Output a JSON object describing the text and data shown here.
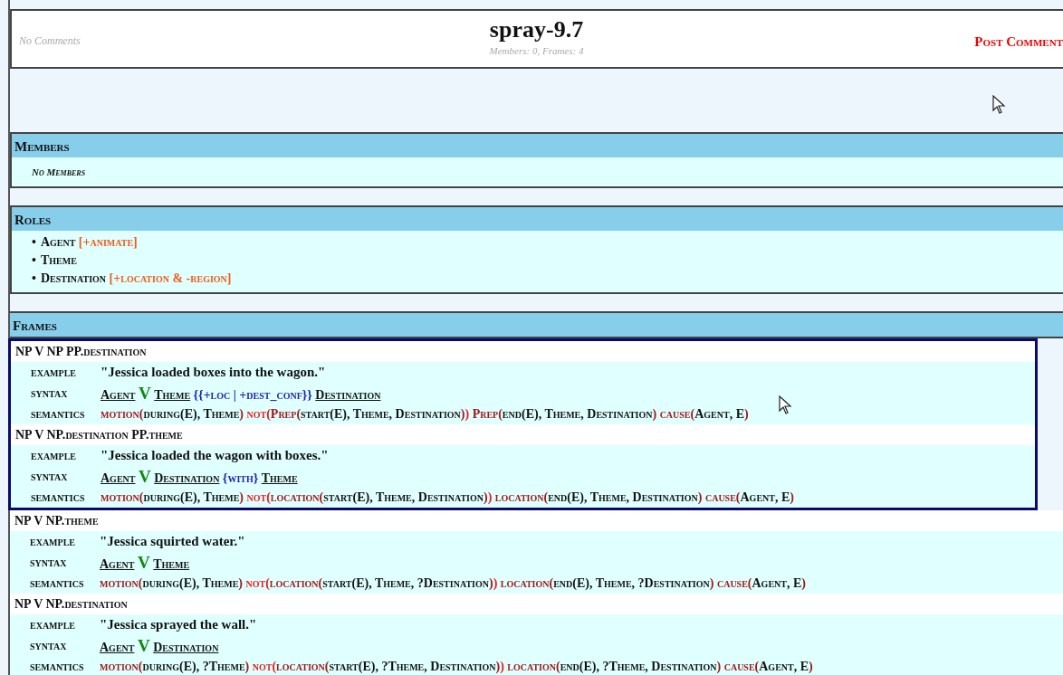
{
  "header": {
    "comments": "No Comments",
    "title": "spray-9.7",
    "subtitle": "Members: 0, Frames: 4",
    "post_link": "Post Comment"
  },
  "members": {
    "heading": "Members",
    "empty_text": "No Members"
  },
  "roles": {
    "heading": "Roles",
    "bullet": "•",
    "items": [
      {
        "name": "Agent",
        "restriction": "[+animate]"
      },
      {
        "name": "Theme"
      },
      {
        "name": "Destination",
        "restriction": "[+location & -region]"
      }
    ]
  },
  "frames": {
    "heading": "Frames",
    "items": [
      {
        "highlighted": true,
        "description": [
          {
            "kind": "main",
            "text": "NP V NP PP."
          },
          {
            "kind": "sub",
            "text": "destination"
          }
        ],
        "example_label": "example",
        "example": "\"Jessica loaded boxes into the wagon.\"",
        "syntax_label": "syntax",
        "syntax": [
          {
            "kind": "role",
            "text": "Agent"
          },
          {
            "kind": "verb",
            "text": "V"
          },
          {
            "kind": "role",
            "text": "Theme"
          },
          {
            "kind": "restriction",
            "text": "{{+loc | +dest_conf}}"
          },
          {
            "kind": "role",
            "text": "Destination"
          }
        ],
        "semantics_label": "semantics",
        "semantics": [
          {
            "kind": "pred",
            "text": "motion("
          },
          {
            "kind": "arg",
            "text": "during(E), Theme"
          },
          {
            "kind": "pred",
            "text": ") "
          },
          {
            "kind": "neg",
            "text": "not("
          },
          {
            "kind": "pred",
            "text": "Prep("
          },
          {
            "kind": "arg",
            "text": "start(E), Theme, Destination"
          },
          {
            "kind": "pred",
            "text": ")"
          },
          {
            "kind": "neg",
            "text": ") "
          },
          {
            "kind": "pred",
            "text": "Prep("
          },
          {
            "kind": "arg",
            "text": "end(E), Theme, Destination"
          },
          {
            "kind": "pred",
            "text": ") "
          },
          {
            "kind": "pred",
            "text": "cause("
          },
          {
            "kind": "arg",
            "text": "Agent, E"
          },
          {
            "kind": "pred",
            "text": ")"
          }
        ]
      },
      {
        "highlighted": true,
        "description": [
          {
            "kind": "main",
            "text": "NP V NP."
          },
          {
            "kind": "sub",
            "text": "destination"
          },
          {
            "kind": "main",
            "text": " PP."
          },
          {
            "kind": "sub",
            "text": "theme"
          }
        ],
        "example_label": "example",
        "example": "\"Jessica loaded the wagon with boxes.\"",
        "syntax_label": "syntax",
        "syntax": [
          {
            "kind": "role",
            "text": "Agent"
          },
          {
            "kind": "verb",
            "text": "V"
          },
          {
            "kind": "role",
            "text": "Destination"
          },
          {
            "kind": "restriction",
            "text": "{with}"
          },
          {
            "kind": "role",
            "text": "Theme"
          }
        ],
        "semantics_label": "semantics",
        "semantics": [
          {
            "kind": "pred",
            "text": "motion("
          },
          {
            "kind": "arg",
            "text": "during(E), Theme"
          },
          {
            "kind": "pred",
            "text": ") "
          },
          {
            "kind": "neg",
            "text": "not("
          },
          {
            "kind": "pred",
            "text": "location("
          },
          {
            "kind": "arg",
            "text": "start(E), Theme, Destination"
          },
          {
            "kind": "pred",
            "text": ")"
          },
          {
            "kind": "neg",
            "text": ") "
          },
          {
            "kind": "pred",
            "text": "location("
          },
          {
            "kind": "arg",
            "text": "end(E), Theme, Destination"
          },
          {
            "kind": "pred",
            "text": ") "
          },
          {
            "kind": "pred",
            "text": "cause("
          },
          {
            "kind": "arg",
            "text": "Agent, E"
          },
          {
            "kind": "pred",
            "text": ")"
          }
        ]
      },
      {
        "highlighted": false,
        "description": [
          {
            "kind": "main",
            "text": "NP V NP."
          },
          {
            "kind": "sub",
            "text": "theme"
          }
        ],
        "example_label": "example",
        "example": "\"Jessica squirted water.\"",
        "syntax_label": "syntax",
        "syntax": [
          {
            "kind": "role",
            "text": "Agent"
          },
          {
            "kind": "verb",
            "text": "V"
          },
          {
            "kind": "role",
            "text": "Theme"
          }
        ],
        "semantics_label": "semantics",
        "semantics": [
          {
            "kind": "pred",
            "text": "motion("
          },
          {
            "kind": "arg",
            "text": "during(E), Theme"
          },
          {
            "kind": "pred",
            "text": ") "
          },
          {
            "kind": "neg",
            "text": "not("
          },
          {
            "kind": "pred",
            "text": "location("
          },
          {
            "kind": "arg",
            "text": "start(E), Theme, ?Destination"
          },
          {
            "kind": "pred",
            "text": ")"
          },
          {
            "kind": "neg",
            "text": ") "
          },
          {
            "kind": "pred",
            "text": "location("
          },
          {
            "kind": "arg",
            "text": "end(E), Theme, ?Destination"
          },
          {
            "kind": "pred",
            "text": ") "
          },
          {
            "kind": "pred",
            "text": "cause("
          },
          {
            "kind": "arg",
            "text": "Agent, E"
          },
          {
            "kind": "pred",
            "text": ")"
          }
        ]
      },
      {
        "highlighted": false,
        "description": [
          {
            "kind": "main",
            "text": "NP V NP."
          },
          {
            "kind": "sub",
            "text": "destination"
          }
        ],
        "example_label": "example",
        "example": "\"Jessica sprayed the wall.\"",
        "syntax_label": "syntax",
        "syntax": [
          {
            "kind": "role",
            "text": "Agent"
          },
          {
            "kind": "verb",
            "text": "V"
          },
          {
            "kind": "role",
            "text": "Destination"
          }
        ],
        "semantics_label": "semantics",
        "semantics": [
          {
            "kind": "pred",
            "text": "motion("
          },
          {
            "kind": "arg",
            "text": "during(E), ?Theme"
          },
          {
            "kind": "pred",
            "text": ") "
          },
          {
            "kind": "neg",
            "text": "not("
          },
          {
            "kind": "pred",
            "text": "location("
          },
          {
            "kind": "arg",
            "text": "start(E), ?Theme, Destination"
          },
          {
            "kind": "pred",
            "text": ")"
          },
          {
            "kind": "neg",
            "text": ") "
          },
          {
            "kind": "pred",
            "text": "location("
          },
          {
            "kind": "arg",
            "text": "end(E), ?Theme, Destination"
          },
          {
            "kind": "pred",
            "text": ") "
          },
          {
            "kind": "pred",
            "text": "cause("
          },
          {
            "kind": "arg",
            "text": "Agent, E"
          },
          {
            "kind": "pred",
            "text": ")"
          }
        ]
      }
    ]
  }
}
